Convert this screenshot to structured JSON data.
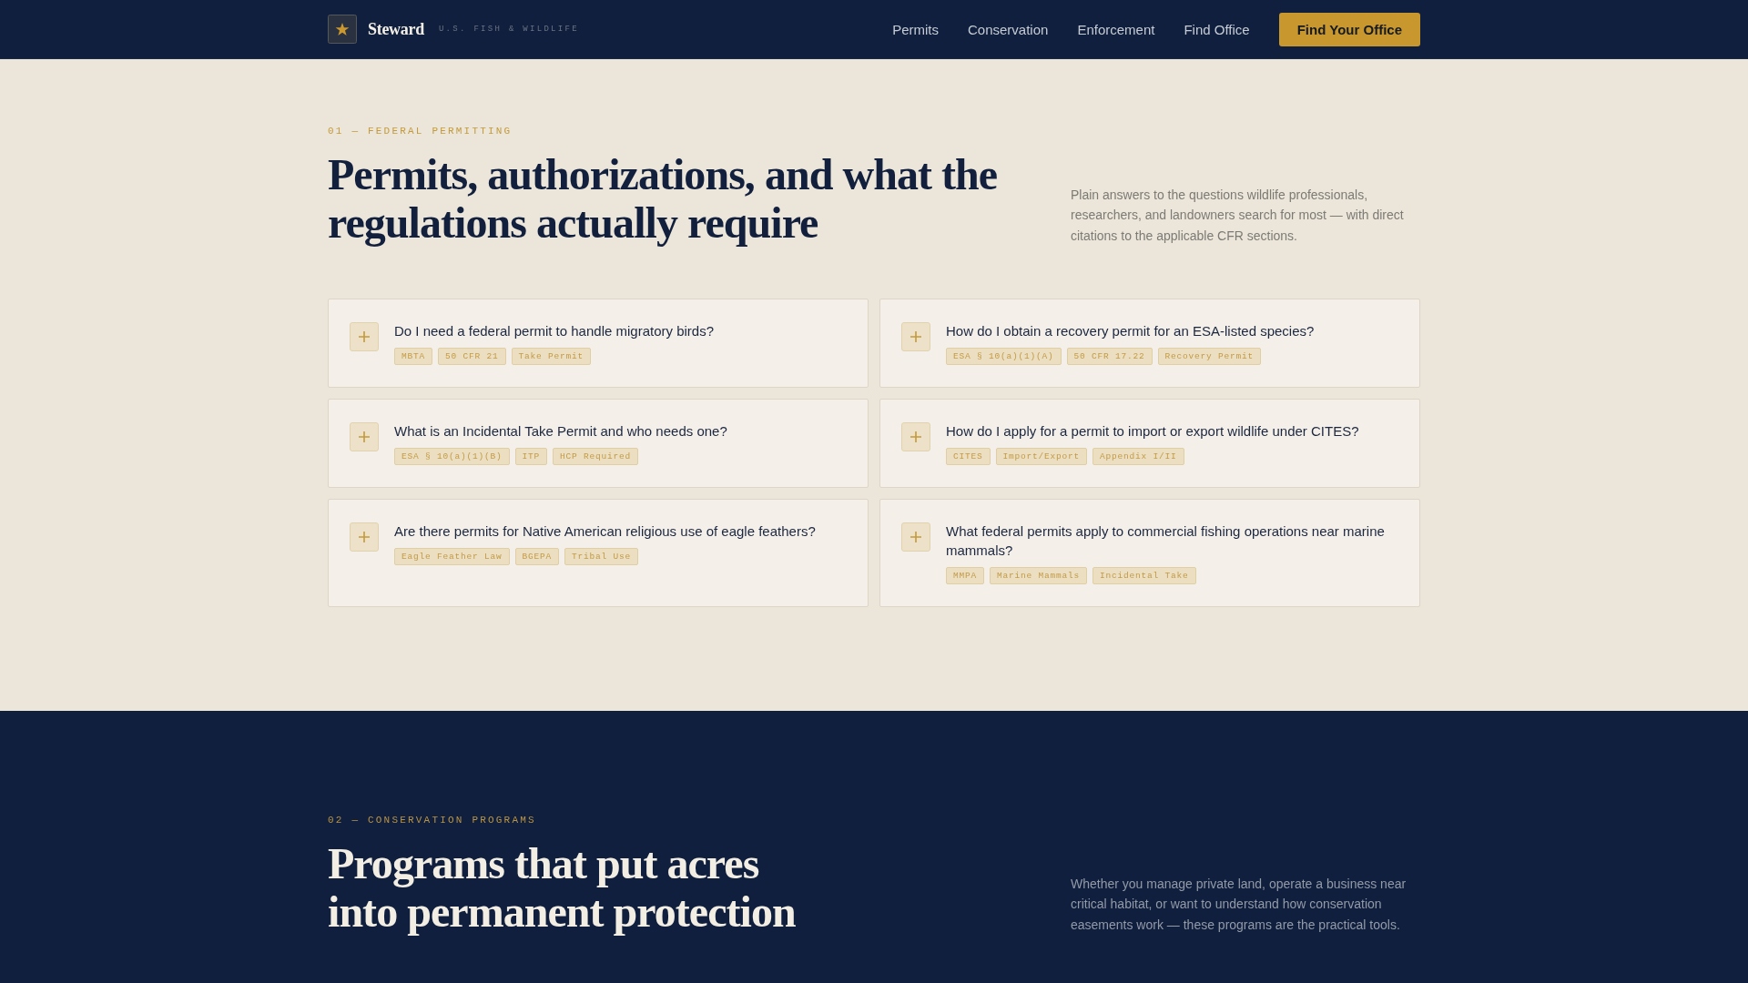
{
  "header": {
    "brand": "Steward",
    "tagline": "U.S. FISH & WILDLIFE",
    "nav": [
      "Permits",
      "Conservation",
      "Enforcement",
      "Find Office"
    ],
    "cta": "Find Your Office"
  },
  "sections": [
    {
      "kind": "light",
      "eyebrow": "01 — FEDERAL PERMITTING",
      "heading": "Permits, authorizations, and what the regulations actually require",
      "intro": "Plain answers to the questions wildlife professionals, researchers, and landowners search for most — with direct citations to the applicable CFR sections.",
      "faqs": [
        {
          "question": "Do I need a federal permit to handle migratory birds?",
          "expanded": false,
          "tags": [
            "MBTA",
            "50 CFR 21",
            "Take Permit"
          ]
        },
        {
          "question": "How do I obtain a recovery permit for an ESA-listed species?",
          "expanded": false,
          "tags": [
            "ESA § 10(a)(1)(A)",
            "50 CFR 17.22",
            "Recovery Permit"
          ]
        },
        {
          "question": "What is an Incidental Take Permit and who needs one?",
          "expanded": false,
          "tags": [
            "ESA § 10(a)(1)(B)",
            "ITP",
            "HCP Required"
          ]
        },
        {
          "question": "How do I apply for a permit to import or export wildlife under CITES?",
          "expanded": false,
          "tags": [
            "CITES",
            "Import/Export",
            "Appendix I/II"
          ]
        },
        {
          "question": "Are there permits for Native American religious use of eagle feathers?",
          "expanded": false,
          "tags": [
            "Eagle Feather Law",
            "BGEPA",
            "Tribal Use"
          ]
        },
        {
          "question": "What federal permits apply to commercial fishing operations near marine mammals?",
          "expanded": false,
          "tags": [
            "MMPA",
            "Marine Mammals",
            "Incidental Take"
          ]
        }
      ]
    },
    {
      "kind": "dark",
      "eyebrow": "02 — CONSERVATION PROGRAMS",
      "heading": "Programs that put acres into permanent protection",
      "intro": "Whether you manage private land, operate a business near critical habitat, or want to understand how conservation easements work — these programs are the practical tools."
    }
  ]
}
